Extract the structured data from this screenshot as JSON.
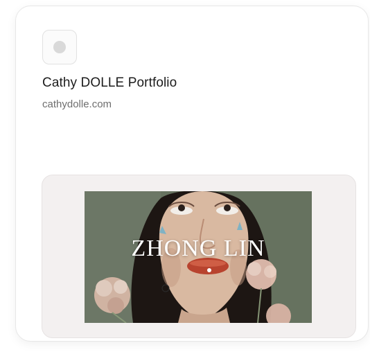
{
  "link_card": {
    "favicon": "placeholder-favicon-icon",
    "title": "Cathy DOLLE Portfolio",
    "url": "cathydolle.com",
    "preview": {
      "description": "portrait-photo-with-flowers",
      "brand_text": "ZHONG LIN"
    }
  },
  "colors": {
    "card_border": "#e7e7e7",
    "panel_bg": "#f3f0f0",
    "image_bg": "#606b5e",
    "title_text": "#1c1c1c",
    "url_text": "#6e6e6e"
  }
}
